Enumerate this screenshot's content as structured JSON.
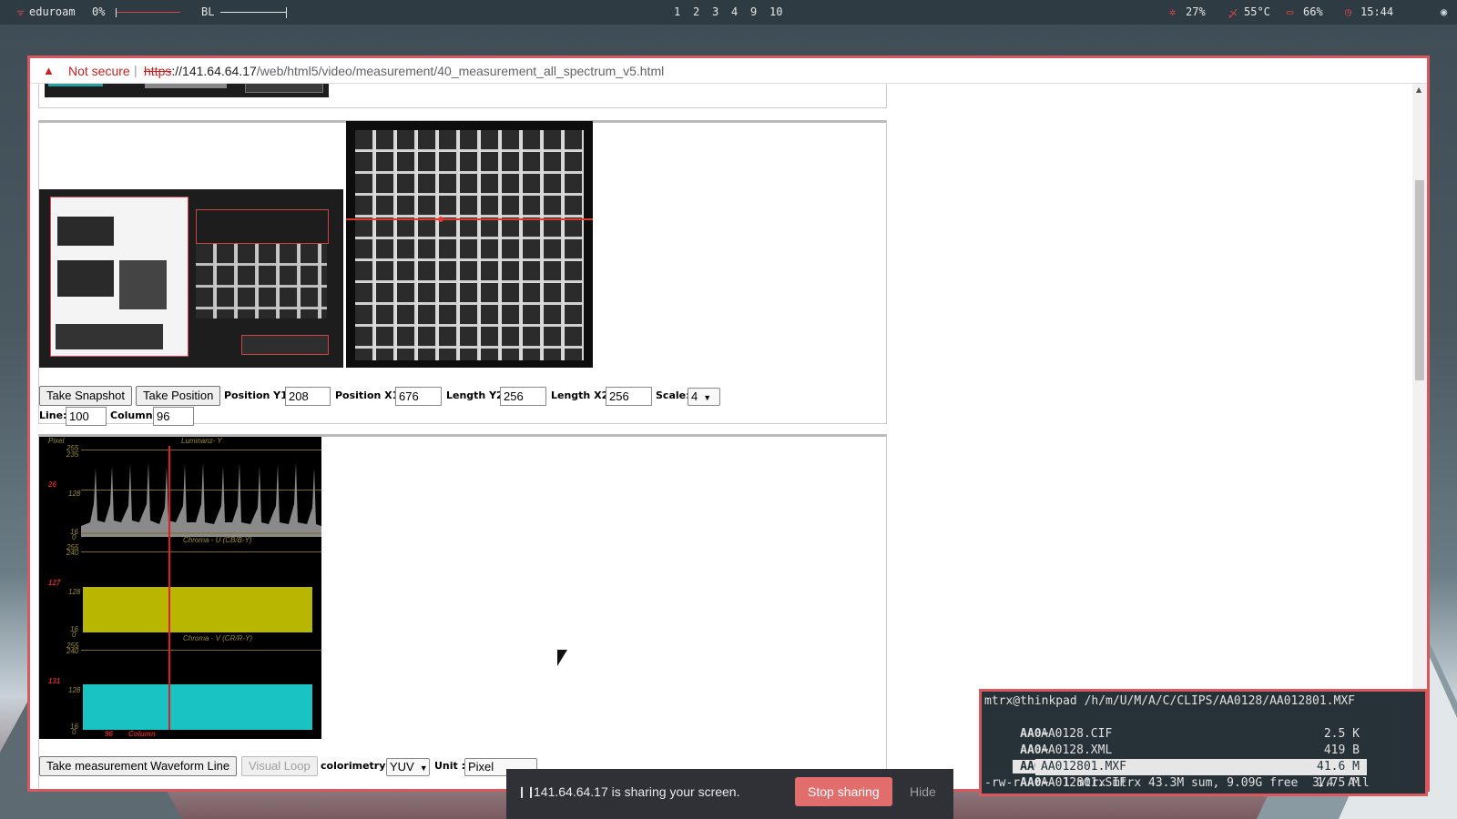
{
  "topbar": {
    "wifi": "eduroam",
    "volume": "0%",
    "backlight": "BL",
    "workspaces": [
      "1",
      "2",
      "3",
      "4",
      "9",
      "10"
    ],
    "cpu": "27%",
    "temp": "55°C",
    "battery": "66%",
    "clock": "15:44"
  },
  "browser": {
    "security_label": "Not secure",
    "url_scheme": "https",
    "url_host": "://141.64.64.17",
    "url_path": "/web/html5/video/measurement/40_measurement_all_spectrum_v5.html"
  },
  "controls": {
    "snapshot_button": "Take Snapshot",
    "position_button": "Take Position",
    "pos_y1_label": "Position Y1:",
    "pos_y1_value": "208",
    "pos_x1_label": "Position X1:",
    "pos_x1_value": "676",
    "len_y2_label": "Length Y2:",
    "len_y2_value": "256",
    "len_x2_label": "Length X2:",
    "len_x2_value": "256",
    "scale_label": "Scale:",
    "scale_value": "4",
    "line_label": "Line:",
    "line_value": "100",
    "column_label": "Column:",
    "column_value": "96"
  },
  "scope": {
    "pixel_label": "Pixel",
    "luma_title": "Luminanz- Y",
    "cb_title": "Chroma - U (CB/B-Y)",
    "cr_title": "Chroma - V (CR/R-Y)",
    "luma_marker": "26",
    "cb_marker": "127",
    "cr_marker": "131",
    "column_marker": "96",
    "column_label": "Column",
    "ticks": {
      "t255": "255",
      "t235": "235",
      "t240": "240",
      "t128": "128",
      "t16": "16",
      "t0": "0"
    }
  },
  "bottom_controls": {
    "waveform_button": "Take measurement Waveform Line",
    "visual_loop_button": "Visual Loop",
    "colorimetry_label": "colorimetry :",
    "colorimetry_value": "YUV",
    "unit_label": "Unit :",
    "unit_value": "Pixel"
  },
  "sharebar": {
    "message": "141.64.64.17 is sharing your screen.",
    "stop": "Stop sharing",
    "hide": "Hide"
  },
  "terminal": {
    "header": "mtrx@thinkpad /h/m/U/M/A/C/CLIPS/AA0128/AA012801.MXF",
    "files": [
      {
        "tag": " AA0~ ",
        "name": "AA0128.CIF",
        "size": "2.5 K"
      },
      {
        "tag": " AA0~ ",
        "name": "AA0128.XML",
        "size": "419 B"
      },
      {
        "tag": " AA0~ ",
        "name": "AA012801.MXF",
        "size": "41.6 M"
      },
      {
        "tag": " AA0~ ",
        "name": "AA012801.SIF",
        "size": "1.75 M"
      }
    ],
    "footer": "-rw-r--r-- 1 mtrx mtrx 43.3M sum, 9.09G free  3/4  All"
  }
}
